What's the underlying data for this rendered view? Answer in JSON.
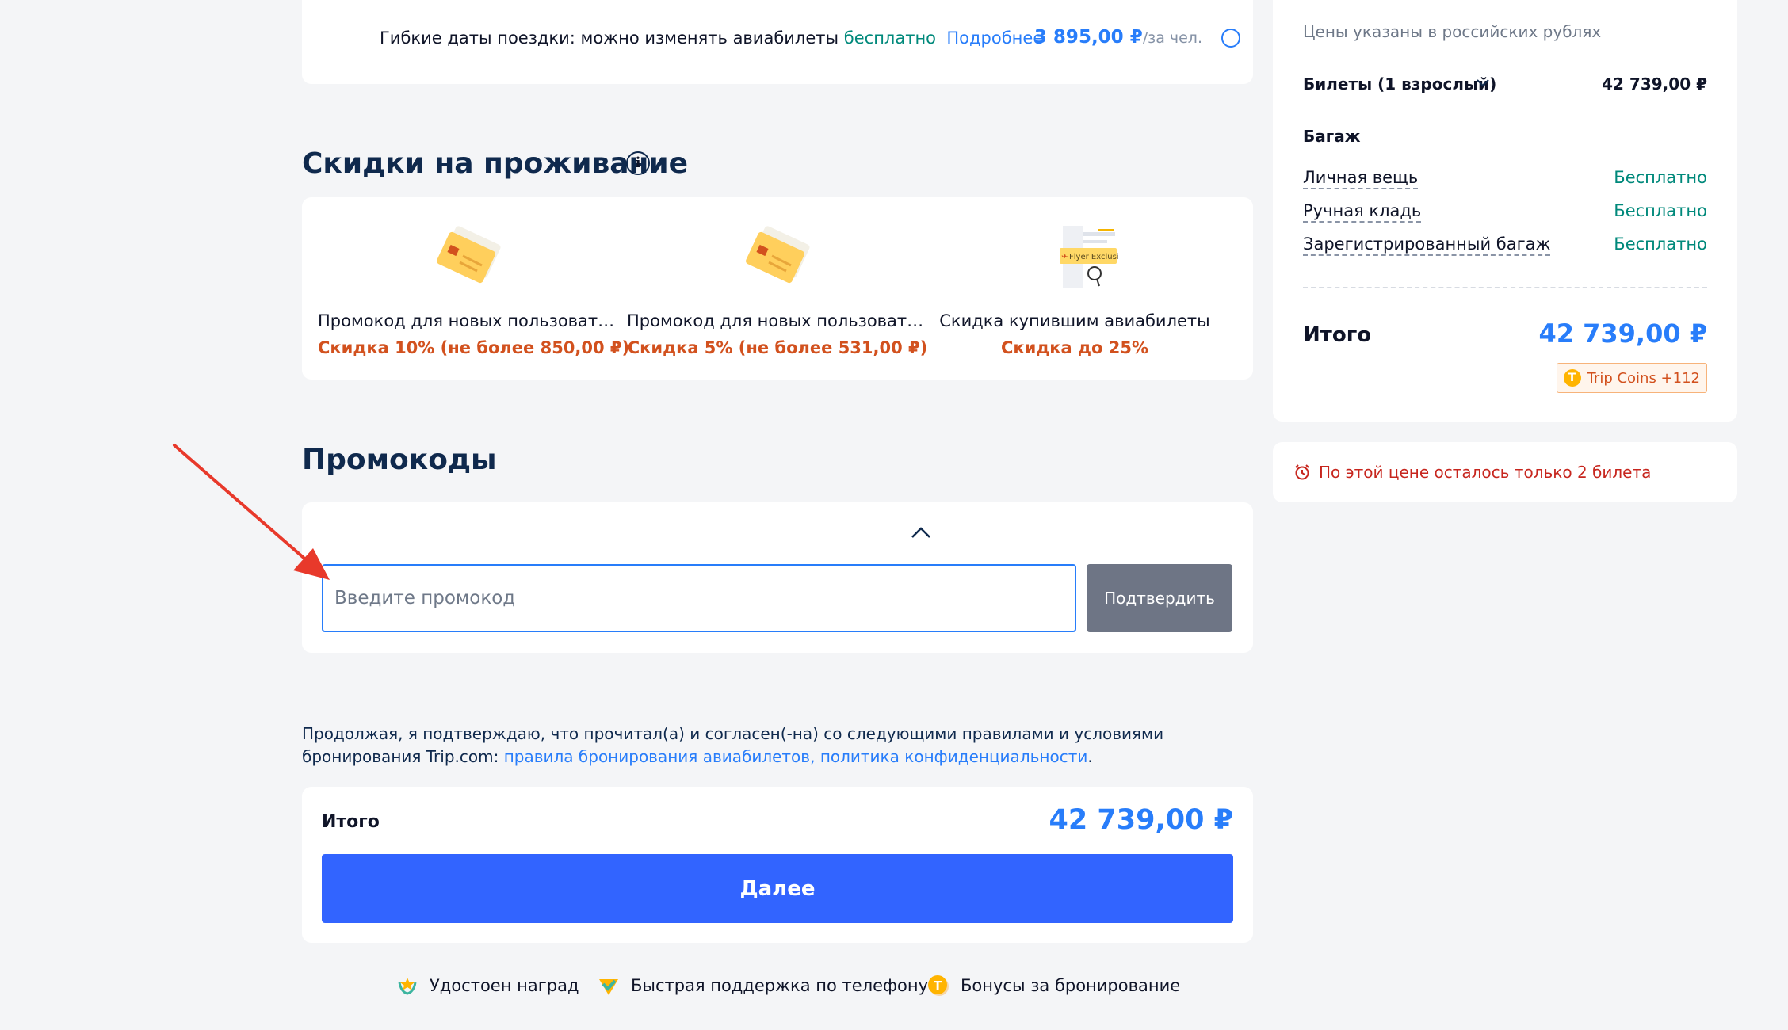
{
  "flex_dates": {
    "text": "Гибкие даты поездки: можно изменять авиабилеты",
    "free": "бесплатно",
    "more_link": "Подробнее",
    "price": "3 895,00 ₽",
    "per": "/за чел."
  },
  "stay_discounts": {
    "title": "Скидки на проживание",
    "info_icon": "info-icon",
    "items": [
      {
        "name": "Промокод для новых пользовател...",
        "desc": "Скидка 10% (не более 850,00 ₽)",
        "icon": "coupon-icon"
      },
      {
        "name": "Промокод для новых пользовател...",
        "desc": "Скидка 5% (не более 531,00 ₽)",
        "icon": "coupon-icon"
      },
      {
        "name": "Скидка купившим авиабилеты",
        "desc": "Скидка до 25%",
        "icon": "flyer-exclusive-icon",
        "badge": "Flyer Exclusive"
      }
    ]
  },
  "promo": {
    "title": "Промокоды",
    "placeholder": "Введите промокод",
    "value": "",
    "confirm_label": "Подтвердить"
  },
  "terms": {
    "text": "Продолжая, я подтверждаю, что прочитал(а) и согласен(-на) со следующими правилами и условиями бронирования Trip.com: ",
    "link1": "правила бронирования авиабилетов",
    "sep": ", ",
    "link2": "политика конфиденциальности",
    "end": "."
  },
  "total": {
    "label": "Итого",
    "value": "42 739,00 ₽",
    "next_label": "Далее"
  },
  "badges": [
    {
      "label": "Удостоен наград",
      "icon": "award-icon"
    },
    {
      "label": "Быстрая поддержка по телефону",
      "icon": "support-check-icon"
    },
    {
      "label": "Бонусы за бронирование",
      "icon": "coin-icon"
    }
  ],
  "summary": {
    "price_note": "Цены указаны в российских рублях",
    "tickets_label": "Билеты (1 взрослый)",
    "tickets_value": "42 739,00 ₽",
    "baggage_title": "Багаж",
    "baggage": [
      {
        "name": "Личная вещь",
        "value": "Бесплатно"
      },
      {
        "name": "Ручная кладь",
        "value": "Бесплатно"
      },
      {
        "name": "Зарегистрированный багаж",
        "value": "Бесплатно"
      }
    ],
    "total_label": "Итого",
    "total_value": "42 739,00 ₽",
    "coins_label": "Trip Coins +112",
    "coin_glyph": "T"
  },
  "alert": {
    "text": "По этой цене осталось только 2 билета",
    "icon": "alarm-clock-icon"
  },
  "colors": {
    "accent": "#287dfa",
    "primary_button": "#3264ff",
    "discount_orange": "#d2511e",
    "free_green": "#00897b",
    "alert_red": "#c7261e",
    "annotation_arrow": "#e8392b"
  }
}
